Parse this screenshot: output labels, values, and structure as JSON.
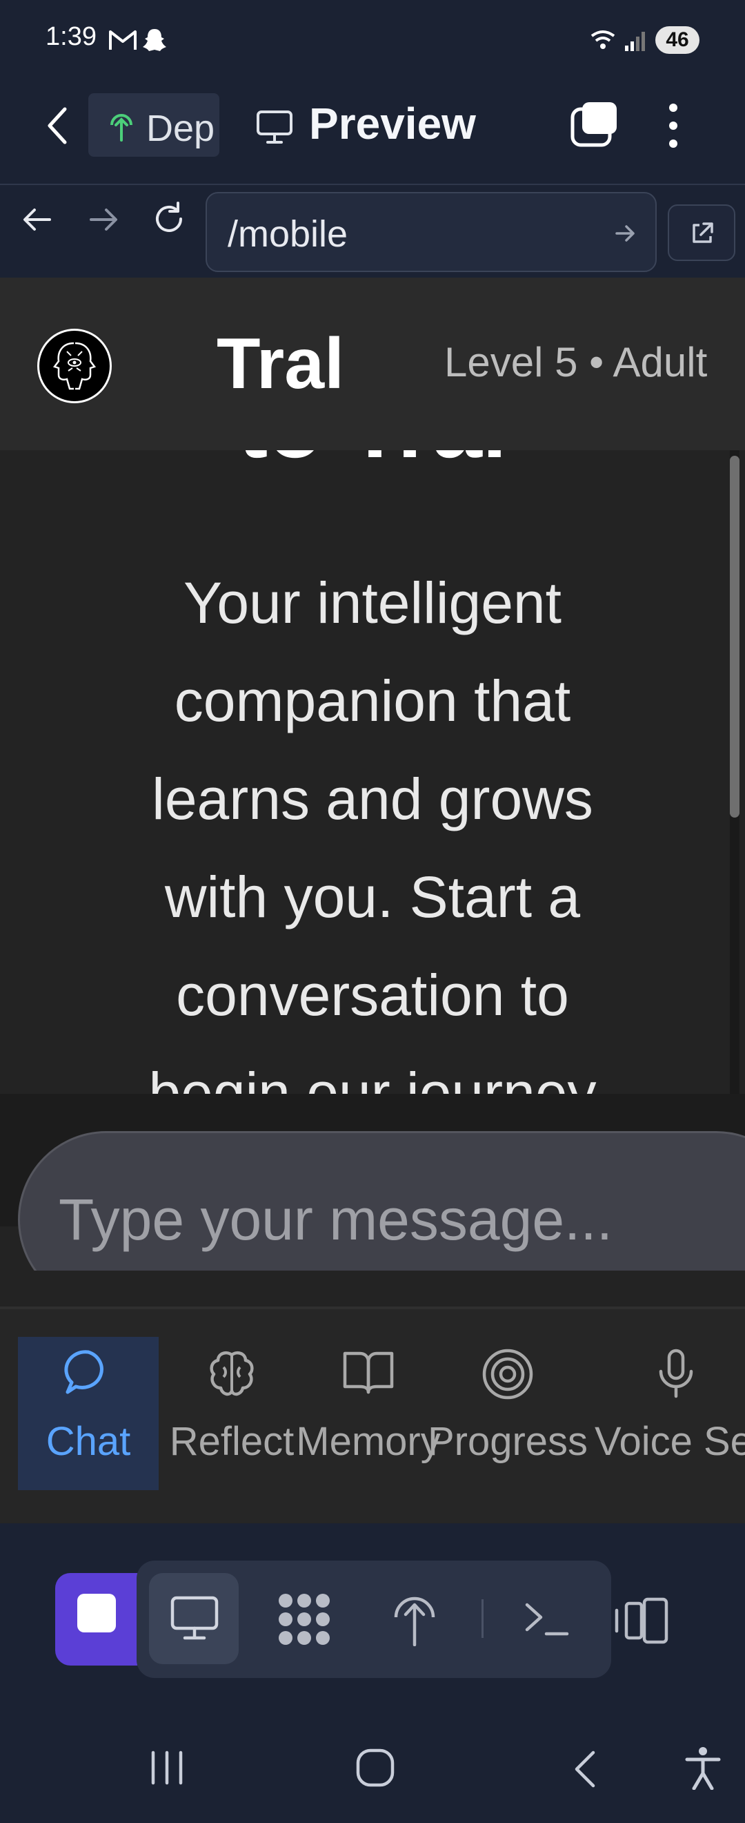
{
  "status_bar": {
    "time": "1:39",
    "battery": "46"
  },
  "app_header": {
    "deploy_tab_label": "Dep",
    "preview_title": "Preview"
  },
  "browser": {
    "url": "/mobile"
  },
  "web_app": {
    "name": "Tral",
    "level": "Level 5 • Adult",
    "welcome_heading": "to Tral",
    "intro": "Your intelligent companion that learns and grows with you. Start a conversation to begin our journey",
    "input_placeholder": "Type your message...",
    "nav": [
      {
        "label": "Chat",
        "icon": "chat-bubble-icon",
        "active": true
      },
      {
        "label": "Reflect",
        "icon": "brain-icon",
        "active": false
      },
      {
        "label": "Memory",
        "icon": "book-icon",
        "active": false
      },
      {
        "label": "Progress",
        "icon": "target-icon",
        "active": false
      },
      {
        "label": "Voice Se",
        "icon": "microphone-icon",
        "active": false
      }
    ]
  },
  "colors": {
    "accent_blue": "#5aa4ff",
    "stop_purple": "#5b3fd6",
    "deploy_green": "#4ccf7a"
  }
}
